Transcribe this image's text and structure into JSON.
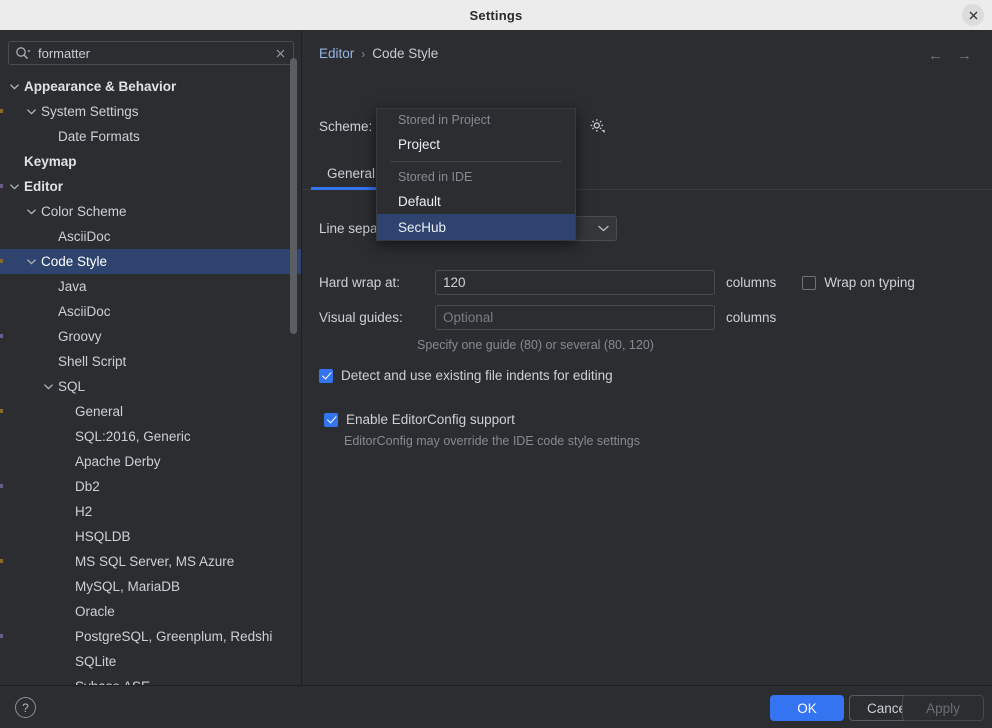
{
  "window": {
    "title": "Settings",
    "close_icon": "close-icon"
  },
  "sidebar": {
    "search": {
      "value": "formatter",
      "placeholder": "",
      "icon": "search-icon",
      "clear_icon": "close-icon"
    },
    "tree": [
      {
        "label": "Appearance & Behavior",
        "indent": 0,
        "caret": "expanded",
        "bold": true,
        "selected": false
      },
      {
        "label": "System Settings",
        "indent": 1,
        "caret": "expanded",
        "bold": false,
        "selected": false
      },
      {
        "label": "Date Formats",
        "indent": 2,
        "caret": "none",
        "bold": false,
        "selected": false
      },
      {
        "label": "Keymap",
        "indent": 0,
        "caret": "none",
        "bold": true,
        "selected": false
      },
      {
        "label": "Editor",
        "indent": 0,
        "caret": "expanded",
        "bold": true,
        "selected": false
      },
      {
        "label": "Color Scheme",
        "indent": 1,
        "caret": "expanded",
        "bold": false,
        "selected": false
      },
      {
        "label": "AsciiDoc",
        "indent": 2,
        "caret": "none",
        "bold": false,
        "selected": false
      },
      {
        "label": "Code Style",
        "indent": 1,
        "caret": "expanded",
        "bold": false,
        "selected": true
      },
      {
        "label": "Java",
        "indent": 2,
        "caret": "none",
        "bold": false,
        "selected": false
      },
      {
        "label": "AsciiDoc",
        "indent": 2,
        "caret": "none",
        "bold": false,
        "selected": false
      },
      {
        "label": "Groovy",
        "indent": 2,
        "caret": "none",
        "bold": false,
        "selected": false
      },
      {
        "label": "Shell Script",
        "indent": 2,
        "caret": "none",
        "bold": false,
        "selected": false
      },
      {
        "label": "SQL",
        "indent": 2,
        "caret": "expanded",
        "bold": false,
        "selected": false
      },
      {
        "label": "General",
        "indent": 3,
        "caret": "none",
        "bold": false,
        "selected": false
      },
      {
        "label": "SQL:2016, Generic",
        "indent": 3,
        "caret": "none",
        "bold": false,
        "selected": false
      },
      {
        "label": "Apache Derby",
        "indent": 3,
        "caret": "none",
        "bold": false,
        "selected": false
      },
      {
        "label": "Db2",
        "indent": 3,
        "caret": "none",
        "bold": false,
        "selected": false
      },
      {
        "label": "H2",
        "indent": 3,
        "caret": "none",
        "bold": false,
        "selected": false
      },
      {
        "label": "HSQLDB",
        "indent": 3,
        "caret": "none",
        "bold": false,
        "selected": false
      },
      {
        "label": "MS SQL Server, MS Azure",
        "indent": 3,
        "caret": "none",
        "bold": false,
        "selected": false
      },
      {
        "label": "MySQL, MariaDB",
        "indent": 3,
        "caret": "none",
        "bold": false,
        "selected": false
      },
      {
        "label": "Oracle",
        "indent": 3,
        "caret": "none",
        "bold": false,
        "selected": false
      },
      {
        "label": "PostgreSQL, Greenplum, Redshi",
        "indent": 3,
        "caret": "none",
        "bold": false,
        "selected": false
      },
      {
        "label": "SQLite",
        "indent": 3,
        "caret": "none",
        "bold": false,
        "selected": false
      },
      {
        "label": "Sybase ASE",
        "indent": 3,
        "caret": "none",
        "bold": false,
        "selected": false
      }
    ]
  },
  "main": {
    "breadcrumb": {
      "root": "Editor",
      "separator": "›",
      "current": "Code Style"
    },
    "nav": {
      "back_icon": "arrow-left-icon",
      "forward_icon": "arrow-right-icon"
    },
    "scheme": {
      "label": "Scheme:",
      "selected_name": "SecHub",
      "selected_scope": "IDE",
      "chevron_icon": "chevron-down-icon",
      "gear_icon": "gear-icon"
    },
    "tabs": [
      {
        "label": "General",
        "active": true
      }
    ],
    "fields": {
      "line_separator_label": "Line separator:",
      "line_separator_value": "",
      "hard_wrap_label": "Hard wrap at:",
      "hard_wrap_value": "120",
      "hard_wrap_unit": "columns",
      "wrap_on_typing_label": "Wrap on typing",
      "wrap_on_typing_checked": false,
      "visual_guides_label": "Visual guides:",
      "visual_guides_value": "",
      "visual_guides_placeholder": "Optional",
      "visual_guides_unit": "columns",
      "visual_guides_hint": "Specify one guide (80) or several (80, 120)",
      "detect_indents_label": "Detect and use existing file indents for editing",
      "detect_indents_checked": true,
      "editorconfig_label": "Enable EditorConfig support",
      "editorconfig_checked": true,
      "editorconfig_hint": "EditorConfig may override the IDE code style settings"
    }
  },
  "scheme_popup": {
    "groups": [
      {
        "title": "Stored in Project",
        "items": [
          {
            "label": "Project",
            "selected": false
          }
        ]
      },
      {
        "title": "Stored in IDE",
        "items": [
          {
            "label": "Default",
            "selected": false
          },
          {
            "label": "SecHub",
            "selected": true
          }
        ]
      }
    ]
  },
  "footer": {
    "help_label": "?",
    "ok_label": "OK",
    "cancel_label": "Cancel",
    "apply_label": "Apply"
  },
  "colors": {
    "accent": "#3574f0",
    "selection": "#2e436e",
    "background": "#2b2d30",
    "titlebar": "#ececec"
  }
}
